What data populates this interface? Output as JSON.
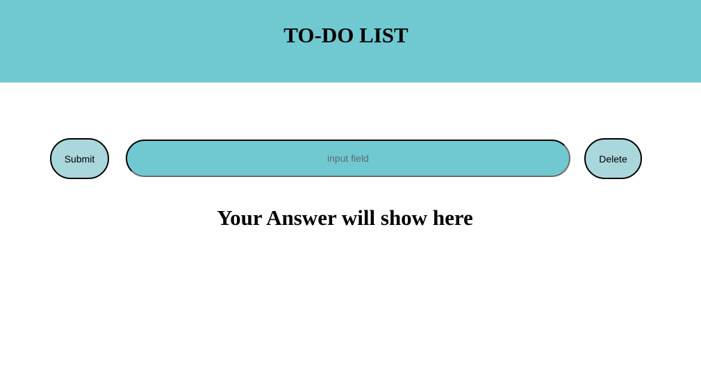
{
  "header": {
    "title": "TO-DO LIST"
  },
  "controls": {
    "submit_label": "Submit",
    "input_value": "",
    "input_placeholder": "input field",
    "delete_label": "Delete"
  },
  "output": {
    "answer_text": "Your Answer will show here"
  },
  "colors": {
    "header_bg": "#70c9d1",
    "button_bg": "#aad7db",
    "input_bg": "#70c9d1"
  }
}
